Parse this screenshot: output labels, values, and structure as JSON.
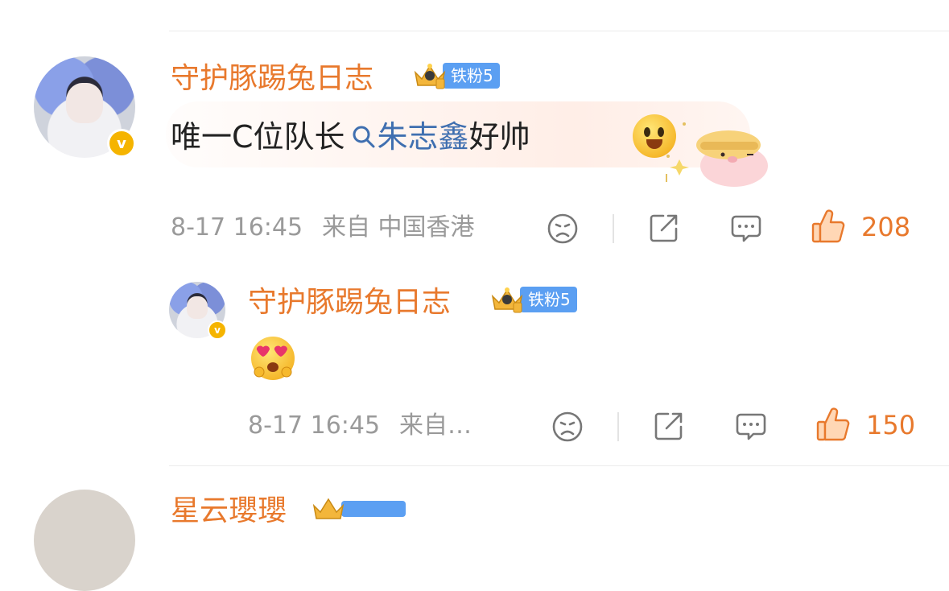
{
  "comment": {
    "username": "守护豚踢兔日志",
    "fan_badge": "铁粉5",
    "content_prefix": "唯一C位队长",
    "topic_link": "朱志鑫",
    "content_suffix": "好帅",
    "time": "8-17 16:45",
    "source": "来自 中国香港",
    "like_count": "208",
    "icons": [
      "dislike-face-icon",
      "share-icon",
      "comment-icon",
      "like-thumb-icon"
    ],
    "colors": {
      "username": "#e8792d",
      "link": "#3f6fb0",
      "badge": "#5b9ff2"
    }
  },
  "reply": {
    "username": "守护豚踢兔日志",
    "fan_badge": "铁粉5",
    "time": "8-17 16:45",
    "source": "来自…",
    "like_count": "150",
    "icons": [
      "heart-eyes-emoji-icon",
      "dislike-face-icon",
      "share-icon",
      "comment-icon",
      "like-thumb-icon"
    ]
  },
  "next_comment": {
    "username": "星云瓔瓔"
  }
}
